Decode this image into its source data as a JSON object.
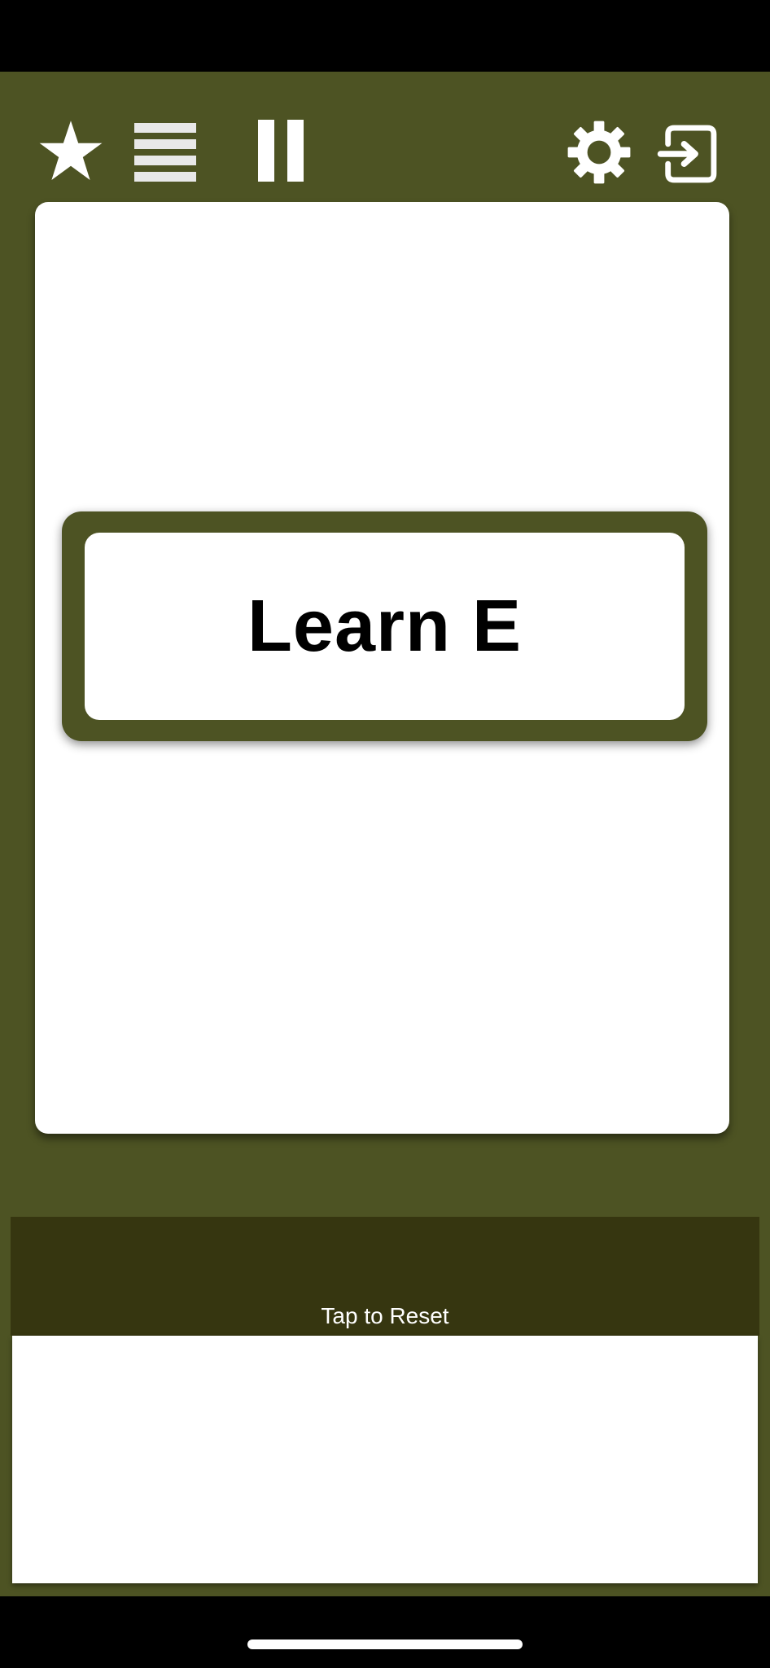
{
  "toolbar": {
    "favorite_icon": "star-icon",
    "menu_icon": "list-icon",
    "pause_icon": "pause-icon",
    "settings_icon": "gear-icon",
    "exit_icon": "exit-icon"
  },
  "card": {
    "word": "Learn E"
  },
  "reset": {
    "label": "Tap to Reset"
  },
  "colors": {
    "background": "#4d5323",
    "reset_bar": "#363610",
    "card": "#ffffff",
    "icon": "#ffffff"
  }
}
